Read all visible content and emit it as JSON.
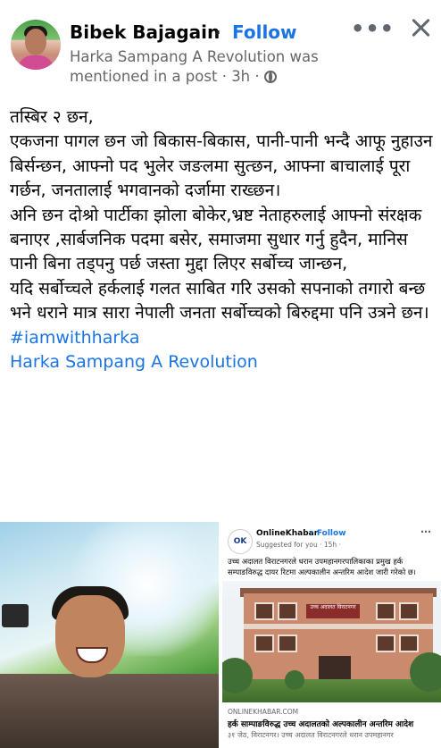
{
  "post": {
    "author": "Bibek Bajagain",
    "separator": "·",
    "follow_label": "Follow",
    "more_label": "•••",
    "mention_text": "Harka Sampang A Revolution was mentioned in a post",
    "time": "3h",
    "time_sep": "·",
    "privacy_icon": "globe-icon",
    "body_lines": [
      "तस्बिर २ छन,",
      "एकजना पागल छन जो बिकास-बिकास, पानी-पानी भन्दै आफू नुहाउन बिर्सन्छन, आफ्नो पद भुलेर जङलमा सुत्छन, आफ्ना बाचालाई पूरा गर्छन, जनतालाई भगवानको दर्जामा राख्छन।",
      "अनि छन दोश्रो पार्टीका झोला बोकेर,भ्रष्ट नेताहरुलाई आफ्नो संरक्षक बनाएर ,सार्बजनिक पदमा बसेर,  समाजमा सुधार गर्नु हुदैन, मानिस पानी बिना तड्पनु पर्छ जस्ता मुद्दा लिएर सर्बोच्च जान्छन,",
      "यदि सर्बोच्चले हर्कलाई गलत साबित गरि उसको सपनाको तगारो बन्छ भने धराने मात्र सारा नेपाली जनता सर्बोच्चको बिरुद्दमा पनि उत्रने छन।"
    ],
    "hashtag": "#iamwithharka",
    "mention_link": "Harka Sampang A Revolution"
  },
  "embedded": {
    "logo_text": "OK",
    "page_name": "OnlineKhabar",
    "follow_label": "• Follow",
    "suggested": "Suggested for you · 15h ·",
    "text": "उच्च अदालत विराटनगरले धरान उपमहानगरपालिकाका प्रमुख हर्क सम्पाङविरुद्ध दायर रिटमा अल्पकालीन अन्तरिम आदेश जारी गरेको छ।",
    "sign_text": "उच्च अदालत विराटनगर",
    "source": "ONLINEKHABAR.COM",
    "title": "हर्क साम्पाङविरुद्ध उच्च अदालतको अल्पकालीन अन्तरिम आदेश",
    "desc": "३१ जेठ, विराटनगर। उच्च अदालत विराटनगरले धरान उपमहानगर"
  }
}
